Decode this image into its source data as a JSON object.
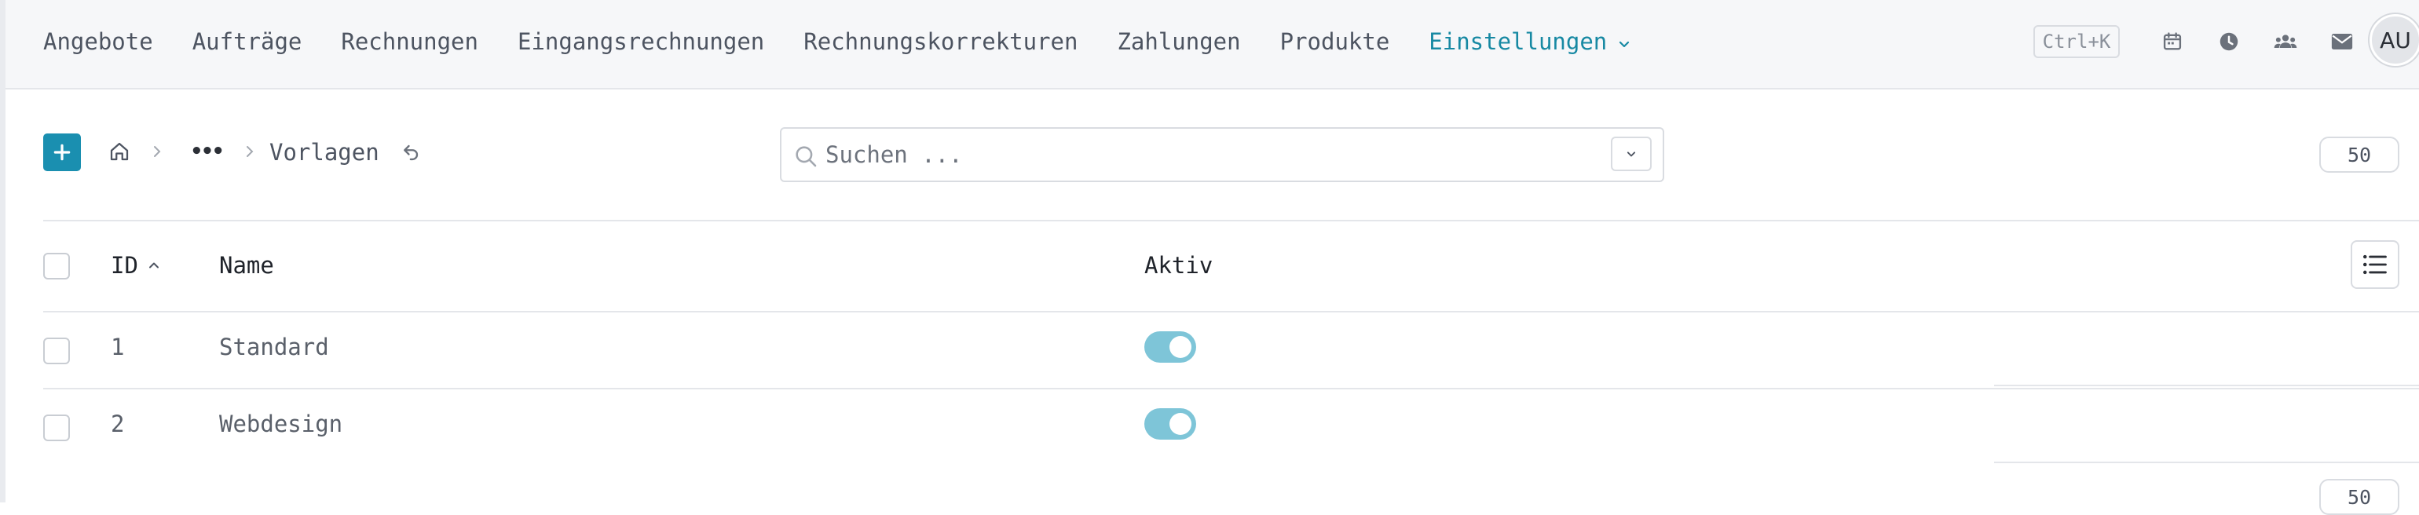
{
  "nav": {
    "items": [
      {
        "label": "Angebote"
      },
      {
        "label": "Aufträge"
      },
      {
        "label": "Rechnungen"
      },
      {
        "label": "Eingangsrechnungen"
      },
      {
        "label": "Rechnungskorrekturen"
      },
      {
        "label": "Zahlungen"
      },
      {
        "label": "Produkte"
      },
      {
        "label": "Einstellungen"
      }
    ],
    "active_index": 7,
    "shortcut": "Ctrl+K",
    "icons": [
      "calendar-icon",
      "clock-icon",
      "team-icon",
      "mail-icon"
    ],
    "avatar_initials": "AU"
  },
  "toolbar": {
    "add_icon": "plus-icon",
    "breadcrumb": {
      "home_icon": "home-icon",
      "ellipsis": "•••",
      "current": "Vorlagen",
      "reload_icon": "undo-icon"
    },
    "search": {
      "placeholder": "Suchen ..."
    },
    "page_size": "50"
  },
  "table": {
    "columns": {
      "id": "ID",
      "name": "Name",
      "active": "Aktiv"
    },
    "sort_column": "ID",
    "sort_direction": "ascending",
    "rows": [
      {
        "id": "1",
        "name": "Standard",
        "active": true
      },
      {
        "id": "2",
        "name": "Webdesign",
        "active": true
      }
    ]
  },
  "footer": {
    "page_size": "50"
  },
  "colors": {
    "accent": "#1a8fb0",
    "active_nav": "#1789a3",
    "toggle_on": "#7ec5d8"
  }
}
